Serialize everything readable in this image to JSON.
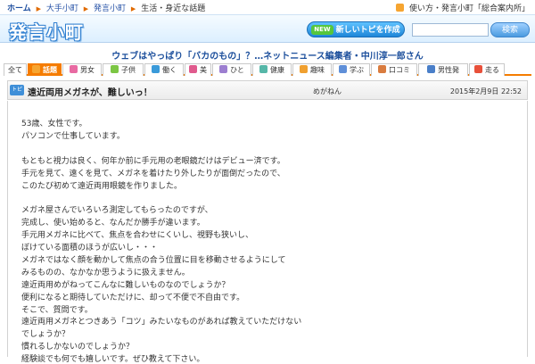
{
  "breadcrumb": {
    "home": "ホーム",
    "items": [
      "大手小町",
      "発言小町",
      "生活・身近な話題"
    ]
  },
  "help_link": "使い方・発言小町「総合案内所」",
  "logo": "発言小町",
  "new_topic_badge": "NEW",
  "new_topic_button": "新しいトピを作成",
  "search_button": "検索",
  "banner": "ウェブはやっぱり「バカのもの」？…ネットニュース編集者・中川淳一郎さん",
  "tabs": [
    {
      "label": "全て",
      "color": ""
    },
    {
      "label": "話題",
      "color": "#f6a531"
    },
    {
      "label": "男女",
      "color": "#e86aa2"
    },
    {
      "label": "子供",
      "color": "#7cc644"
    },
    {
      "label": "働く",
      "color": "#3a9ad9"
    },
    {
      "label": "美",
      "color": "#e05a8d"
    },
    {
      "label": "ひと",
      "color": "#9c7ed0"
    },
    {
      "label": "健康",
      "color": "#56b7a8"
    },
    {
      "label": "趣味",
      "color": "#f0a030"
    },
    {
      "label": "学ぶ",
      "color": "#5f8fd8"
    },
    {
      "label": "口コミ",
      "color": "#d97c3f"
    },
    {
      "label": "男性発",
      "color": "#4a7fc9"
    },
    {
      "label": "走る",
      "color": "#e8503a"
    }
  ],
  "active_tab": "話題",
  "topic": {
    "mark": "トピ",
    "title": "遠近両用メガネが、難しいっ！",
    "author": "めがねん",
    "date": "2015年2月9日 22:52",
    "lines": [
      "53歳、女性です。",
      "パソコンで仕事しています。",
      "",
      "もともと視力は良く、何年か前に手元用の老眼鏡だけはデビュー済です。",
      "手元を見て、遠くを見て、メガネを着けたり外したりが面倒だったので、",
      "このたび初めて遠近両用眼鏡を作りました。",
      "",
      "メガネ屋さんでいろいろ測定してもらったのですが、",
      "完成し、使い始めると、なんだか勝手が違います。",
      "手元用メガネに比べて、焦点を合わせにくいし、視野も狭いし、",
      "ぼけている面積のほうが広いし・・・",
      "メガネではなく顔を動かして焦点の合う位置に目を移動させるようにして",
      "みるものの、なかなか思うように扱えません。",
      "遠近両用めがねってこんなに難しいものなのでしょうか？",
      "便利になると期待していただけに、却って不便で不自由です。",
      "そこで、質問です。",
      "遠近両用メガネとつきあう「コツ」みたいなものがあれば教えていただけない",
      "でしょうか？",
      "慣れるしかないのでしょうか？",
      "経験談でも何でも嬉しいです。ぜひ教えて下さい。"
    ]
  }
}
